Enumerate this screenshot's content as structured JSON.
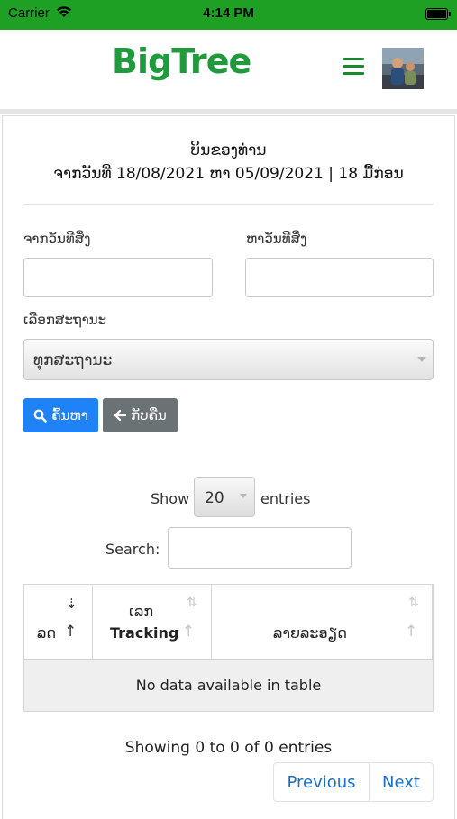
{
  "status_bar": {
    "carrier": "Carrier",
    "time": "4:14 PM"
  },
  "header": {
    "logo_text_1": "BigTr",
    "logo_text_2": "ee",
    "menu_icon": "hamburger-icon",
    "avatar": "user-avatar"
  },
  "page": {
    "title": "ບິນຂອງທ່ານ",
    "date_range": "ຈາກວັນທີ່ 18/08/2021 ຫາ 05/09/2021 | 18 ມື້ກ່ອນ"
  },
  "filters": {
    "from_date_label": "ຈາກວັນທີສິ່ງ",
    "to_date_label": "ຫາວັນທີສິ່ງ",
    "from_date_value": "",
    "to_date_value": "",
    "status_label": "ເລືອກສະຖານະ",
    "status_value": "ທຸກສະຖານະ"
  },
  "buttons": {
    "search_label": "ຄົ້ນຫາ",
    "back_label": "ກັບຄືນ",
    "search_icon": "search-icon",
    "back_icon": "arrow-left-icon"
  },
  "table_controls": {
    "show_label": "Show",
    "page_length": "20",
    "entries_label": "entries",
    "search_label": "Search:",
    "search_value": ""
  },
  "table": {
    "columns": [
      {
        "line1": "",
        "line2": "ລດ"
      },
      {
        "line1": "ເລກ",
        "line2": "Tracking"
      },
      {
        "line1": "",
        "line2": "ລາຍລະອຽດ"
      }
    ],
    "empty_message": "No data available in table"
  },
  "pagination": {
    "info": "Showing 0 to 0 of 0 entries",
    "previous": "Previous",
    "next": "Next"
  },
  "colors": {
    "status_bar": "#1ea024",
    "brand_green": "#1f9a3c",
    "primary": "#1f82f6",
    "secondary": "#6b7276",
    "link": "#1a6fc9"
  }
}
